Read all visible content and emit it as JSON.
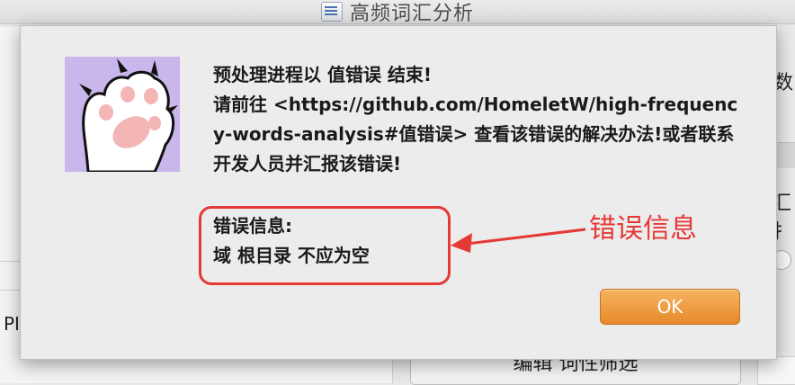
{
  "window": {
    "title": "高频词汇分析"
  },
  "background": {
    "left_label": "PI",
    "right_text_1": "数",
    "right_text_2": "汇扌",
    "bottom_button_label": "编辑 词性筛选"
  },
  "alert": {
    "line_1": "预处理进程以 值错误 结束!",
    "line_2": "请前往 <https://github.com/HomeletW/high-frequency-words-analysis#值错误> 查看该错误的解决办法!或者联系开发人员并汇报该错误!",
    "error_title": "错误信息:",
    "error_message": "域 根目录 不应为空",
    "ok_label": "OK"
  },
  "annotation": {
    "label": "错误信息",
    "color": "#e53935"
  },
  "icons": {
    "app_icon": "document-chart-icon",
    "alert_icon": "cat-paw-icon"
  }
}
